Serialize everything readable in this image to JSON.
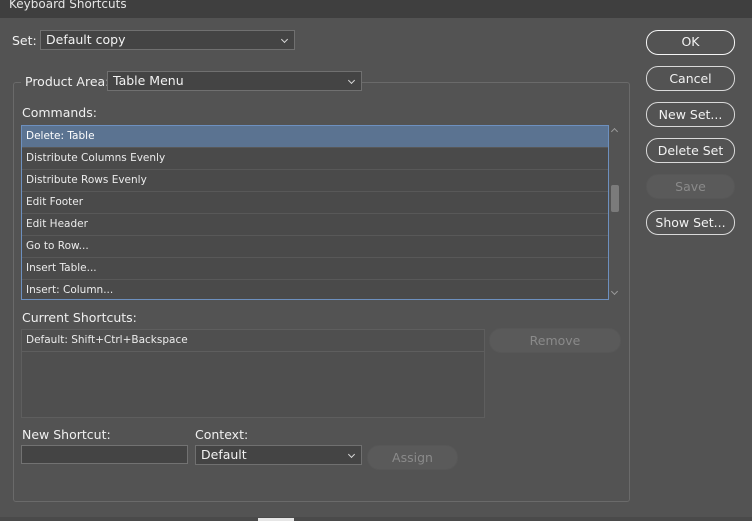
{
  "window": {
    "title": "Keyboard Shortcuts"
  },
  "set": {
    "label": "Set:",
    "value": "Default copy"
  },
  "product_area": {
    "label": "Product Area:",
    "value": "Table Menu"
  },
  "commands": {
    "label": "Commands:",
    "items": [
      "Delete: Table",
      "Distribute Columns Evenly",
      "Distribute Rows Evenly",
      "Edit Footer",
      "Edit Header",
      "Go to Row...",
      "Insert Table...",
      "Insert: Column..."
    ],
    "selected_index": 0,
    "scroll_position": 0.3
  },
  "current_shortcuts": {
    "label": "Current Shortcuts:",
    "items": [
      "Default: Shift+Ctrl+Backspace"
    ]
  },
  "remove_button": "Remove",
  "new_shortcut": {
    "label": "New Shortcut:",
    "value": ""
  },
  "context": {
    "label": "Context:",
    "value": "Default"
  },
  "assign_button": "Assign",
  "buttons": {
    "ok": "OK",
    "cancel": "Cancel",
    "new_set": "New Set...",
    "delete_set": "Delete Set",
    "save": "Save",
    "show_set": "Show Set..."
  },
  "colors": {
    "selection": "#5b7391",
    "background": "#535353",
    "list_border": "#6d90bf"
  }
}
